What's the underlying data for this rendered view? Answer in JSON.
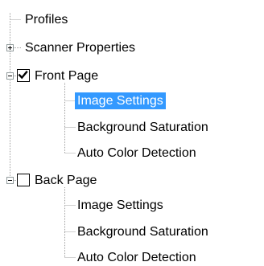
{
  "tree": {
    "profiles": {
      "label": "Profiles"
    },
    "scanner_properties": {
      "label": "Scanner Properties",
      "expanded": false
    },
    "front_page": {
      "label": "Front Page",
      "checked": true,
      "expanded": true,
      "children": [
        {
          "label": "Image Settings",
          "selected": true
        },
        {
          "label": "Background Saturation",
          "selected": false
        },
        {
          "label": "Auto Color Detection",
          "selected": false
        }
      ]
    },
    "back_page": {
      "label": "Back Page",
      "checked": false,
      "expanded": true,
      "children": [
        {
          "label": "Image Settings",
          "selected": false
        },
        {
          "label": "Background Saturation",
          "selected": false
        },
        {
          "label": "Auto Color Detection",
          "selected": false
        }
      ]
    }
  },
  "colors": {
    "selection_background": "#3399ff",
    "selection_text": "#ffffff",
    "tree_lines": "#a0a0a0",
    "expander_border": "#919b9c"
  },
  "icons": {
    "expand": "plus-box-icon",
    "collapse": "minus-box-icon",
    "checked": "checkmark-icon"
  }
}
